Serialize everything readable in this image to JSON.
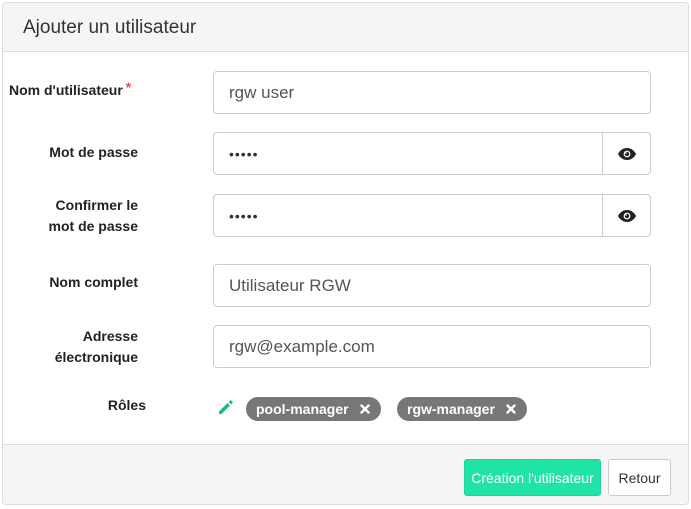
{
  "panel": {
    "title": "Ajouter un utilisateur"
  },
  "form": {
    "username": {
      "label": "Nom d'utilisateur",
      "required_marker": "*",
      "value": "rgw user"
    },
    "password": {
      "label": "Mot de passe",
      "value": "•••••",
      "toggle_icon": "eye-icon"
    },
    "confirm_password": {
      "label_line1": "Confirmer le",
      "label_line2": "mot de passe",
      "value": "•••••",
      "toggle_icon": "eye-icon"
    },
    "full_name": {
      "label": "Nom complet",
      "value": "Utilisateur RGW"
    },
    "email": {
      "label_line1": "Adresse",
      "label_line2": "électronique",
      "value": "rgw@example.com"
    },
    "roles": {
      "label": "Rôles",
      "edit_icon": "pencil-icon",
      "items": [
        {
          "label": "pool-manager",
          "remove_icon": "close-icon"
        },
        {
          "label": "rgw-manager",
          "remove_icon": "close-icon"
        }
      ]
    }
  },
  "footer": {
    "submit_label": "Création l'utilisateur",
    "back_label": "Retour"
  },
  "colors": {
    "primary": "#20e3a8",
    "tag": "#777777",
    "required": "#d9534f",
    "pencil": "#1bb98a"
  }
}
